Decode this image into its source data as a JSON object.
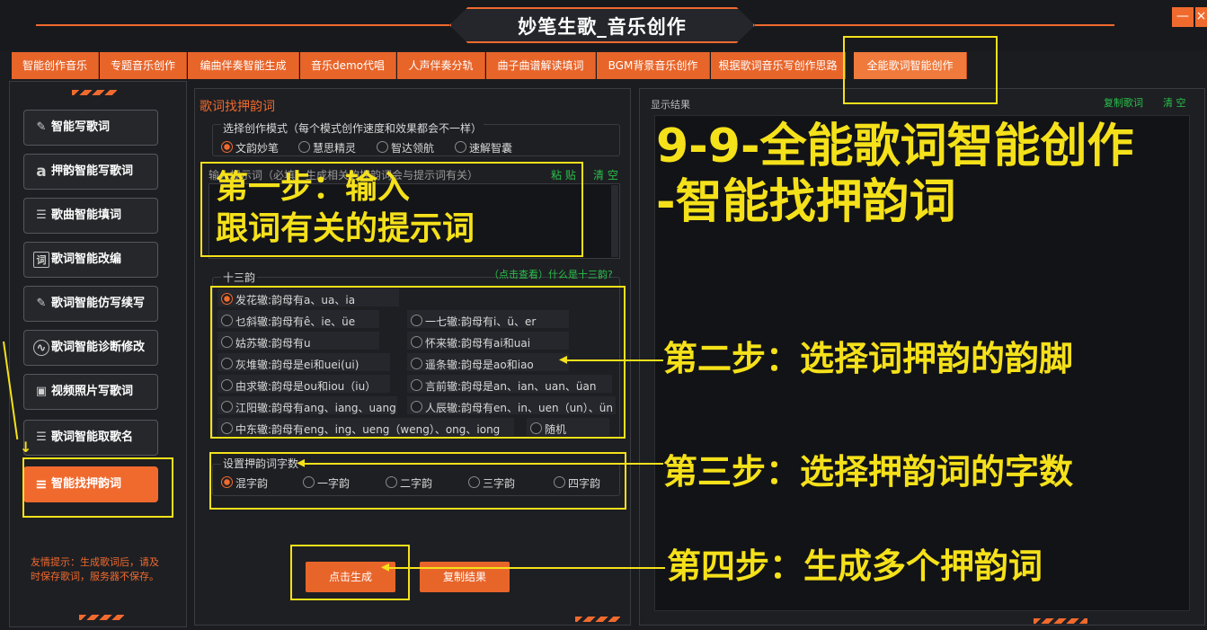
{
  "app": {
    "title": "妙笔生歌_音乐创作",
    "min_label": "—",
    "close_label": "×"
  },
  "tabs": [
    "智能创作音乐",
    "专题音乐创作",
    "编曲伴奏智能生成",
    "音乐demo代唱",
    "人声伴奏分轨",
    "曲子曲谱解读填词",
    "BGM背景音乐创作",
    "根据歌词音乐写创作思路",
    "全能歌词智能创作"
  ],
  "sidebar": {
    "items": [
      {
        "label": "智能写歌词",
        "icon": "pen-icon",
        "glyph": "✎"
      },
      {
        "label": "押韵智能写歌词",
        "icon": "letter-a-icon",
        "glyph": "a"
      },
      {
        "label": "歌曲智能填词",
        "icon": "list-icon",
        "glyph": "☰"
      },
      {
        "label": "歌词智能改编",
        "icon": "word-icon",
        "glyph": "词"
      },
      {
        "label": "歌词智能仿写续写",
        "icon": "pen-icon",
        "glyph": "✎"
      },
      {
        "label": "歌词智能诊断修改",
        "icon": "pulse-icon",
        "glyph": "∿"
      },
      {
        "label": "视频照片写歌词",
        "icon": "image-icon",
        "glyph": "▣"
      },
      {
        "label": "歌词智能取歌名",
        "icon": "tag-icon",
        "glyph": "☰"
      },
      {
        "label": "智能找押韵词",
        "icon": "sliders-icon",
        "glyph": "≡"
      }
    ],
    "tip": "友情提示：生成歌词后，请及时保存歌词，服务器不保存。"
  },
  "panel": {
    "title": "歌词找押韵词",
    "mode": {
      "label": "选择创作模式（每个模式创作速度和效果都会不一样）",
      "options": [
        "文韵妙笔",
        "慧思精灵",
        "智达领航",
        "速解智囊"
      ],
      "selected": 0
    },
    "input": {
      "label": "输入提示词（必填，生成相关的押韵词会与提示词有关）",
      "paste": "粘 贴",
      "clear": "清 空"
    },
    "rhymes": {
      "label": "十三韵",
      "help": "（点击查看）什么是十三韵?",
      "options": [
        "发花辙:韵母有a、ua、ia",
        "乜斜辙:韵母有ê、ie、üe",
        "一七辙:韵母有i、ü、er",
        "姑苏辙:韵母有u",
        "怀来辙:韵母有ai和uai",
        "灰堆辙:韵母是ei和uei(ui)",
        "遥条辙:韵母是ao和iao",
        "由求辙:韵母是ou和iou（iu）",
        "言前辙:韵母是an、ian、uan、üan",
        "江阳辙:韵母有ang、iang、uang",
        "人辰辙:韵母有en、in、uen（un）、ün",
        "中东辙:韵母有eng、ing、ueng（weng）、ong、iong",
        "随机"
      ],
      "selected": 0
    },
    "count": {
      "label": "设置押韵词字数",
      "options": [
        "混字韵",
        "一字韵",
        "二字韵",
        "三字韵",
        "四字韵"
      ],
      "selected": 0
    },
    "generate": "点击生成",
    "copy": "复制结果"
  },
  "result": {
    "label": "显示结果",
    "copy": "复制歌词",
    "clear": "清 空"
  },
  "annotations": {
    "heading_line1": "9-9-全能歌词智能创作",
    "heading_line2": "-智能找押韵词",
    "step1_line1": "第一步：输入",
    "step1_line2": "跟词有关的提示词",
    "step2": "第二步：选择词押韵的韵脚",
    "step3": "第三步：选择押韵词的字数",
    "step4": "第四步：生成多个押韵词"
  },
  "colors": {
    "accent": "#f06a2e",
    "annotation": "#f5e11a",
    "positive": "#29c04a",
    "background": "#1b1c20"
  }
}
